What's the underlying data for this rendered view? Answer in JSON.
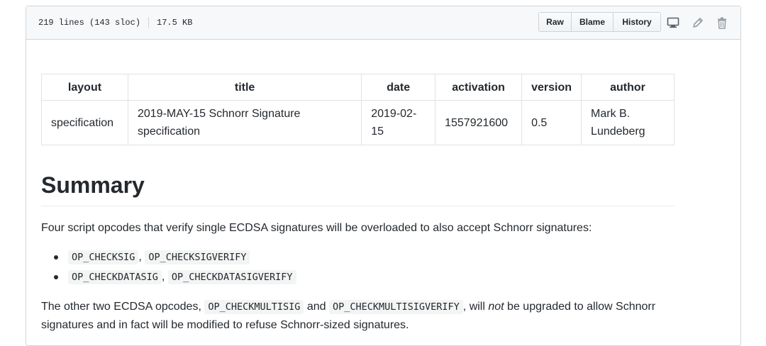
{
  "file_header": {
    "lines": "219 lines (143 sloc)",
    "size": "17.5 KB",
    "buttons": {
      "raw": "Raw",
      "blame": "Blame",
      "history": "History"
    },
    "icons": [
      "desktop-icon",
      "pencil-icon",
      "trash-icon"
    ]
  },
  "meta_table": {
    "headers": {
      "layout": "layout",
      "title": "title",
      "date": "date",
      "activation": "activation",
      "version": "version",
      "author": "author"
    },
    "row": {
      "layout": "specification",
      "title": "2019-MAY-15 Schnorr Signature specification",
      "date": "2019-02-15",
      "activation": "1557921600",
      "version": "0.5",
      "author": "Mark B. Lundeberg"
    }
  },
  "content": {
    "heading": "Summary",
    "intro": "Four script opcodes that verify single ECDSA signatures will be overloaded to also accept Schnorr signatures:",
    "bullets": [
      {
        "code_a": "OP_CHECKSIG",
        "sep": ",",
        "code_b": "OP_CHECKSIGVERIFY"
      },
      {
        "code_a": "OP_CHECKDATASIG",
        "sep": ",",
        "code_b": "OP_CHECKDATASIGVERIFY"
      }
    ],
    "para2": {
      "lead": "The other two ECDSA opcodes, ",
      "code_a": "OP_CHECKMULTISIG",
      "mid": " and ",
      "code_b": "OP_CHECKMULTISIGVERIFY",
      "after": ", will ",
      "em": "not",
      "tail": " be upgraded to allow Schnorr signatures and in fact will be modified to refuse Schnorr-sized signatures."
    }
  },
  "colors": {
    "text": "#24292e",
    "border": "#d1d5da",
    "header_bg": "#f6f8fa",
    "icon": "#959da5"
  }
}
